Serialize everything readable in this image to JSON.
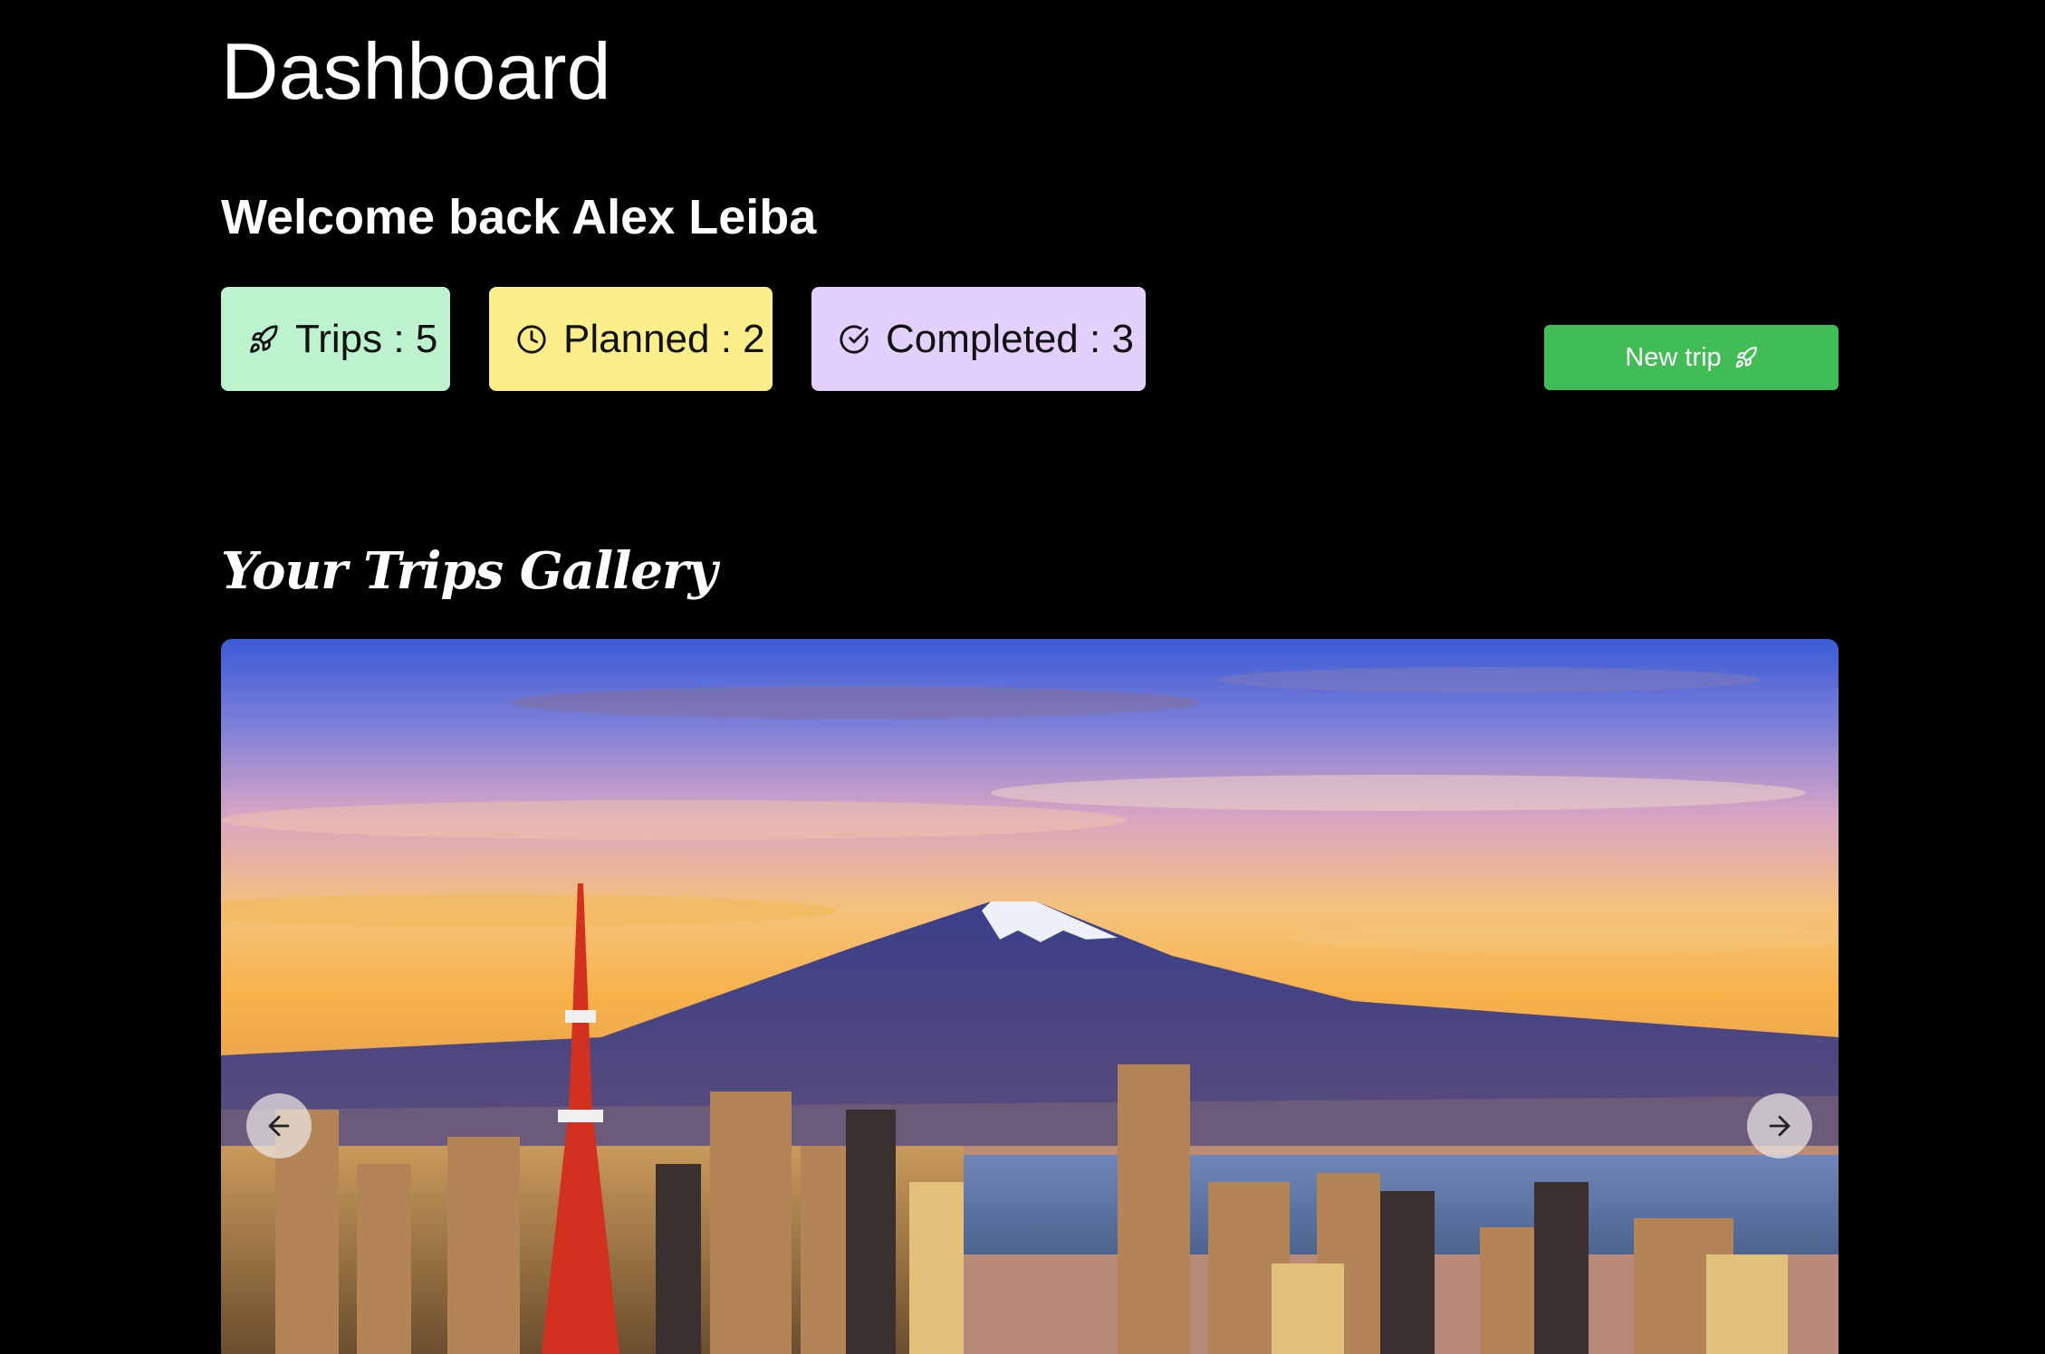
{
  "header": {
    "title": "Dashboard",
    "welcome": "Welcome back Alex Leiba"
  },
  "stats": [
    {
      "label": "Trips : 5",
      "icon": "rocket-icon",
      "color": "#bdf2cf"
    },
    {
      "label": "Planned : 2",
      "icon": "clock-icon",
      "color": "#fcef8a"
    },
    {
      "label": "Completed : 3",
      "icon": "check-circle-icon",
      "color": "#e2d1fd"
    }
  ],
  "actions": {
    "new_trip_label": "New trip",
    "new_trip_icon": "rocket-icon",
    "new_trip_color": "#40be55"
  },
  "gallery": {
    "title": "Your Trips Gallery",
    "image_subject": "Mount Fuji with Tokyo skyline and Tokyo Tower at sunset",
    "prev_icon": "arrow-left-icon",
    "next_icon": "arrow-right-icon"
  }
}
